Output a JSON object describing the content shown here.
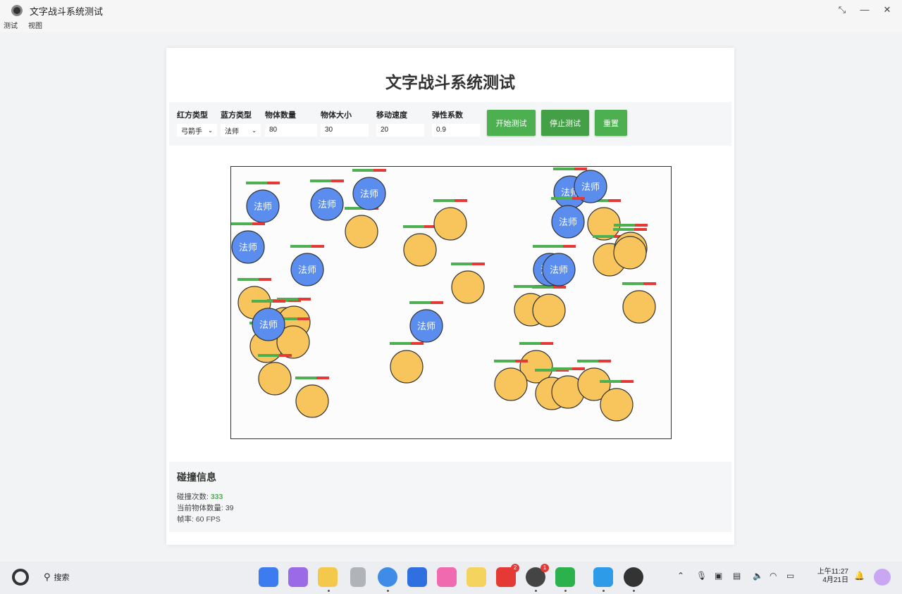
{
  "window": {
    "title": "文字战斗系统测试"
  },
  "menu": [
    "测试",
    "视图"
  ],
  "page": {
    "heading": "文字战斗系统测试"
  },
  "controls": {
    "red_type": {
      "label": "红方类型",
      "value": "弓箭手"
    },
    "blue_type": {
      "label": "蓝方类型",
      "value": "法师"
    },
    "count": {
      "label": "物体数量",
      "value": "80"
    },
    "size": {
      "label": "物体大小",
      "value": "30"
    },
    "speed": {
      "label": "移动速度",
      "value": "20"
    },
    "elasticity": {
      "label": "弹性系数",
      "value": "0.9"
    },
    "start_label": "开始测试",
    "stop_label": "停止测试",
    "reset_label": "重置"
  },
  "arena": {
    "blue_label": "法师",
    "blue_color": "#5b8def",
    "red_color": "#f7c55b"
  },
  "info": {
    "title": "碰撞信息",
    "collisions_label": "碰撞次数: ",
    "collisions_value": "333",
    "objects_label": "当前物体数量: ",
    "objects_value": "39",
    "fps_label": "帧率: ",
    "fps_value": "60 FPS"
  },
  "taskbar": {
    "search_label": "搜索",
    "badge_a": "2",
    "badge_b": "1",
    "time": "上午11:27",
    "date": "4月21日"
  }
}
